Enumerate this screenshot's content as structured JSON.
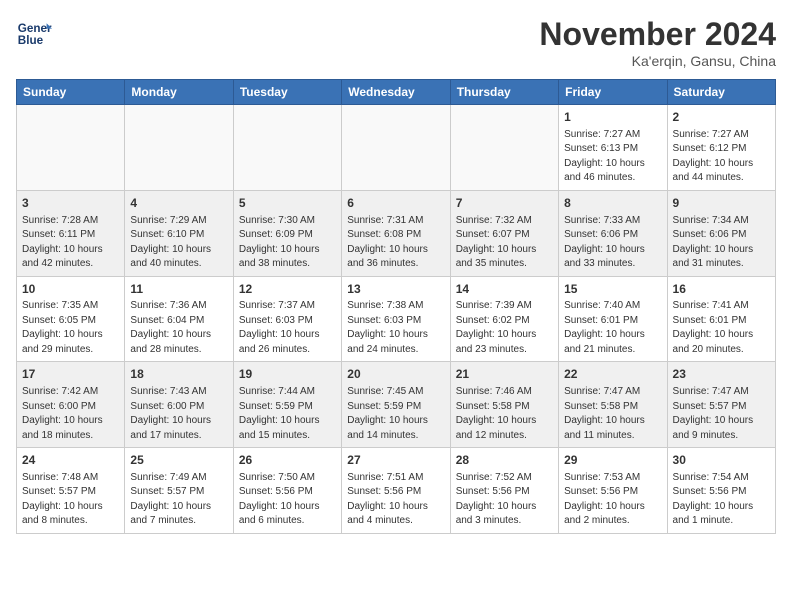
{
  "header": {
    "logo_line1": "General",
    "logo_line2": "Blue",
    "month_title": "November 2024",
    "location": "Ka'erqin, Gansu, China"
  },
  "weekdays": [
    "Sunday",
    "Monday",
    "Tuesday",
    "Wednesday",
    "Thursday",
    "Friday",
    "Saturday"
  ],
  "weeks": [
    [
      {
        "day": "",
        "info": ""
      },
      {
        "day": "",
        "info": ""
      },
      {
        "day": "",
        "info": ""
      },
      {
        "day": "",
        "info": ""
      },
      {
        "day": "",
        "info": ""
      },
      {
        "day": "1",
        "info": "Sunrise: 7:27 AM\nSunset: 6:13 PM\nDaylight: 10 hours and 46 minutes."
      },
      {
        "day": "2",
        "info": "Sunrise: 7:27 AM\nSunset: 6:12 PM\nDaylight: 10 hours and 44 minutes."
      }
    ],
    [
      {
        "day": "3",
        "info": "Sunrise: 7:28 AM\nSunset: 6:11 PM\nDaylight: 10 hours and 42 minutes."
      },
      {
        "day": "4",
        "info": "Sunrise: 7:29 AM\nSunset: 6:10 PM\nDaylight: 10 hours and 40 minutes."
      },
      {
        "day": "5",
        "info": "Sunrise: 7:30 AM\nSunset: 6:09 PM\nDaylight: 10 hours and 38 minutes."
      },
      {
        "day": "6",
        "info": "Sunrise: 7:31 AM\nSunset: 6:08 PM\nDaylight: 10 hours and 36 minutes."
      },
      {
        "day": "7",
        "info": "Sunrise: 7:32 AM\nSunset: 6:07 PM\nDaylight: 10 hours and 35 minutes."
      },
      {
        "day": "8",
        "info": "Sunrise: 7:33 AM\nSunset: 6:06 PM\nDaylight: 10 hours and 33 minutes."
      },
      {
        "day": "9",
        "info": "Sunrise: 7:34 AM\nSunset: 6:06 PM\nDaylight: 10 hours and 31 minutes."
      }
    ],
    [
      {
        "day": "10",
        "info": "Sunrise: 7:35 AM\nSunset: 6:05 PM\nDaylight: 10 hours and 29 minutes."
      },
      {
        "day": "11",
        "info": "Sunrise: 7:36 AM\nSunset: 6:04 PM\nDaylight: 10 hours and 28 minutes."
      },
      {
        "day": "12",
        "info": "Sunrise: 7:37 AM\nSunset: 6:03 PM\nDaylight: 10 hours and 26 minutes."
      },
      {
        "day": "13",
        "info": "Sunrise: 7:38 AM\nSunset: 6:03 PM\nDaylight: 10 hours and 24 minutes."
      },
      {
        "day": "14",
        "info": "Sunrise: 7:39 AM\nSunset: 6:02 PM\nDaylight: 10 hours and 23 minutes."
      },
      {
        "day": "15",
        "info": "Sunrise: 7:40 AM\nSunset: 6:01 PM\nDaylight: 10 hours and 21 minutes."
      },
      {
        "day": "16",
        "info": "Sunrise: 7:41 AM\nSunset: 6:01 PM\nDaylight: 10 hours and 20 minutes."
      }
    ],
    [
      {
        "day": "17",
        "info": "Sunrise: 7:42 AM\nSunset: 6:00 PM\nDaylight: 10 hours and 18 minutes."
      },
      {
        "day": "18",
        "info": "Sunrise: 7:43 AM\nSunset: 6:00 PM\nDaylight: 10 hours and 17 minutes."
      },
      {
        "day": "19",
        "info": "Sunrise: 7:44 AM\nSunset: 5:59 PM\nDaylight: 10 hours and 15 minutes."
      },
      {
        "day": "20",
        "info": "Sunrise: 7:45 AM\nSunset: 5:59 PM\nDaylight: 10 hours and 14 minutes."
      },
      {
        "day": "21",
        "info": "Sunrise: 7:46 AM\nSunset: 5:58 PM\nDaylight: 10 hours and 12 minutes."
      },
      {
        "day": "22",
        "info": "Sunrise: 7:47 AM\nSunset: 5:58 PM\nDaylight: 10 hours and 11 minutes."
      },
      {
        "day": "23",
        "info": "Sunrise: 7:47 AM\nSunset: 5:57 PM\nDaylight: 10 hours and 9 minutes."
      }
    ],
    [
      {
        "day": "24",
        "info": "Sunrise: 7:48 AM\nSunset: 5:57 PM\nDaylight: 10 hours and 8 minutes."
      },
      {
        "day": "25",
        "info": "Sunrise: 7:49 AM\nSunset: 5:57 PM\nDaylight: 10 hours and 7 minutes."
      },
      {
        "day": "26",
        "info": "Sunrise: 7:50 AM\nSunset: 5:56 PM\nDaylight: 10 hours and 6 minutes."
      },
      {
        "day": "27",
        "info": "Sunrise: 7:51 AM\nSunset: 5:56 PM\nDaylight: 10 hours and 4 minutes."
      },
      {
        "day": "28",
        "info": "Sunrise: 7:52 AM\nSunset: 5:56 PM\nDaylight: 10 hours and 3 minutes."
      },
      {
        "day": "29",
        "info": "Sunrise: 7:53 AM\nSunset: 5:56 PM\nDaylight: 10 hours and 2 minutes."
      },
      {
        "day": "30",
        "info": "Sunrise: 7:54 AM\nSunset: 5:56 PM\nDaylight: 10 hours and 1 minute."
      }
    ]
  ]
}
